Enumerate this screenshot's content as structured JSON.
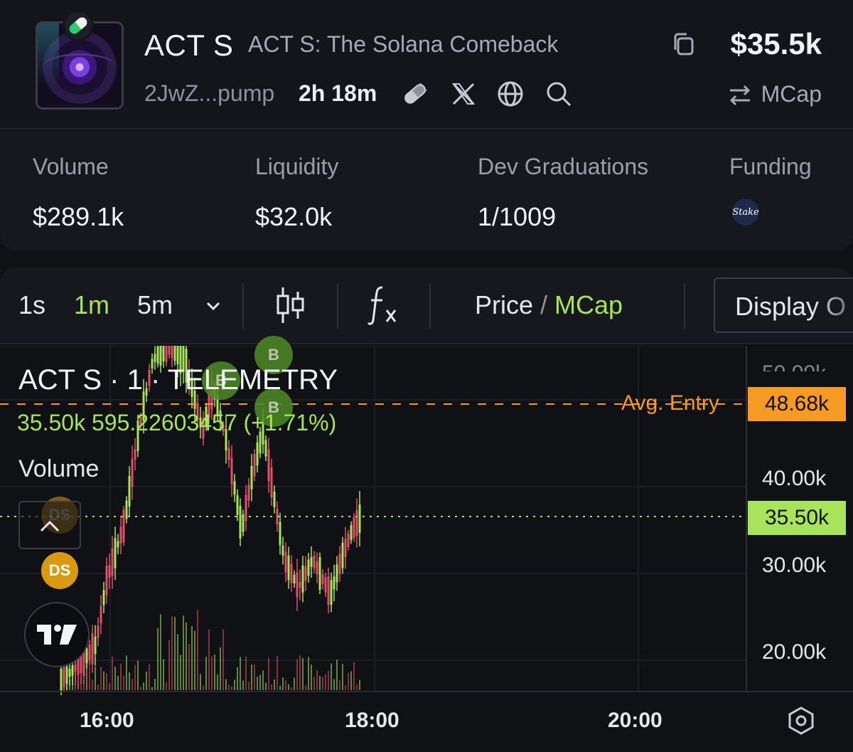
{
  "token": {
    "ticker": "ACT S",
    "name": "ACT S: The Solana Comeback",
    "address": "2JwZ...pump",
    "age": "2h 18m",
    "market_cap": "$35.5k",
    "mcap_toggle_label": "MCap"
  },
  "stats": [
    {
      "label": "Volume",
      "value": "$289.1k"
    },
    {
      "label": "Liquidity",
      "value": "$32.0k"
    },
    {
      "label": "Dev Graduations",
      "value": "1/1009"
    },
    {
      "label": "Funding",
      "value": "",
      "badge_text": "Stake"
    }
  ],
  "toolbar": {
    "timeframes": [
      "1s",
      "1m",
      "5m"
    ],
    "active_timeframe": "1m",
    "price_label": "Price",
    "separator": " / ",
    "mcap_label": "MCap",
    "display_label": "Display O"
  },
  "chart": {
    "legend_title": "ACT S · 1 · TELEMETRY",
    "legend_values": "35.50k  595.22603457 (+1.71%)",
    "volume_label": "Volume",
    "avg_entry_label": "Avg. Entry",
    "avg_entry_value": "48.68k",
    "current_value": "35.50k",
    "top_tick_partial": "50.00k",
    "ds_label": "DS",
    "buy_marker_label": "B"
  },
  "chart_data": {
    "type": "candlestick",
    "y_ticks": [
      "40.00k",
      "30.00k",
      "20.00k"
    ],
    "x_ticks": [
      "16:00",
      "18:00",
      "20:00"
    ],
    "avg_entry": 48.68,
    "current": 35.5,
    "unit": "k"
  },
  "colors": {
    "accent_green": "#a7e35b",
    "candle_up": "#a7e35b",
    "candle_down": "#e0506a",
    "avg_entry": "#f59a23",
    "background": "#101114"
  }
}
